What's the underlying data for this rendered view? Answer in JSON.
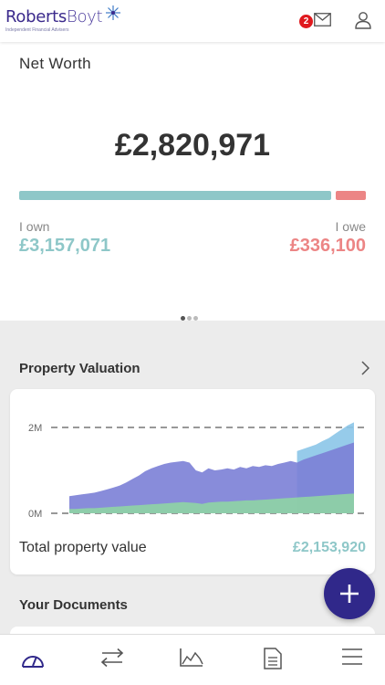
{
  "header": {
    "logo_bold": "Roberts",
    "logo_light": "Boyt",
    "logo_tagline": "Independent Financial Advisers",
    "message_count": "2",
    "icons": [
      "envelope-icon",
      "user-icon"
    ]
  },
  "net_worth": {
    "title": "Net Worth",
    "value": "£2,820,971",
    "own_label": "I own",
    "own_value": "£3,157,071",
    "owe_label": "I owe",
    "owe_value": "£336,100",
    "own_fraction": 0.904,
    "carousel_pages": 3,
    "carousel_active": 0
  },
  "property": {
    "title": "Property Valuation",
    "total_label": "Total property value",
    "total_value": "£2,153,920",
    "chart_data": {
      "type": "area",
      "yticks": [
        "2M",
        "0M"
      ],
      "ylim": [
        0,
        2
      ],
      "series": [
        {
          "color": "#8bc5e8",
          "values": [
            null,
            null,
            null,
            null,
            null,
            null,
            null,
            null,
            null,
            null,
            null,
            null,
            null,
            null,
            null,
            null,
            null,
            null,
            null,
            null,
            null,
            null,
            null,
            null,
            null,
            null,
            null,
            null,
            null,
            null,
            null,
            null,
            null,
            null,
            null,
            null,
            1.45,
            1.5,
            1.55,
            1.6,
            1.68,
            1.75,
            1.85,
            1.95,
            2.05,
            2.12
          ]
        },
        {
          "color": "#7b7fd6",
          "values": [
            0.4,
            0.42,
            0.44,
            0.46,
            0.48,
            0.52,
            0.56,
            0.6,
            0.65,
            0.72,
            0.8,
            0.88,
            0.98,
            1.05,
            1.1,
            1.15,
            1.18,
            1.2,
            1.22,
            1.18,
            1.0,
            0.95,
            1.05,
            1.0,
            1.02,
            1.05,
            1.02,
            1.08,
            1.05,
            1.1,
            1.08,
            1.12,
            1.1,
            1.15,
            1.18,
            1.22,
            1.18,
            1.25,
            1.3,
            1.35,
            1.4,
            1.45,
            1.5,
            1.55,
            1.6,
            1.65
          ]
        },
        {
          "color": "#8fd4a4",
          "values": [
            0.1,
            0.1,
            0.11,
            0.12,
            0.12,
            0.13,
            0.14,
            0.15,
            0.16,
            0.17,
            0.18,
            0.19,
            0.2,
            0.21,
            0.22,
            0.23,
            0.24,
            0.25,
            0.26,
            0.25,
            0.24,
            0.22,
            0.25,
            0.26,
            0.27,
            0.27,
            0.28,
            0.29,
            0.3,
            0.3,
            0.31,
            0.32,
            0.33,
            0.34,
            0.35,
            0.36,
            0.37,
            0.38,
            0.39,
            0.4,
            0.41,
            0.42,
            0.43,
            0.44,
            0.45,
            0.46
          ]
        }
      ]
    }
  },
  "documents": {
    "title": "Your Documents"
  },
  "fab": {
    "icon": "plus-icon"
  },
  "tabbar": {
    "icons": [
      "dashboard-icon",
      "transfer-icon",
      "chart-icon",
      "document-icon",
      "menu-icon"
    ]
  },
  "colors": {
    "brand": "#3b2a8c",
    "own": "#8ec7c8",
    "owe": "#ec8585",
    "fab": "#30288a"
  }
}
